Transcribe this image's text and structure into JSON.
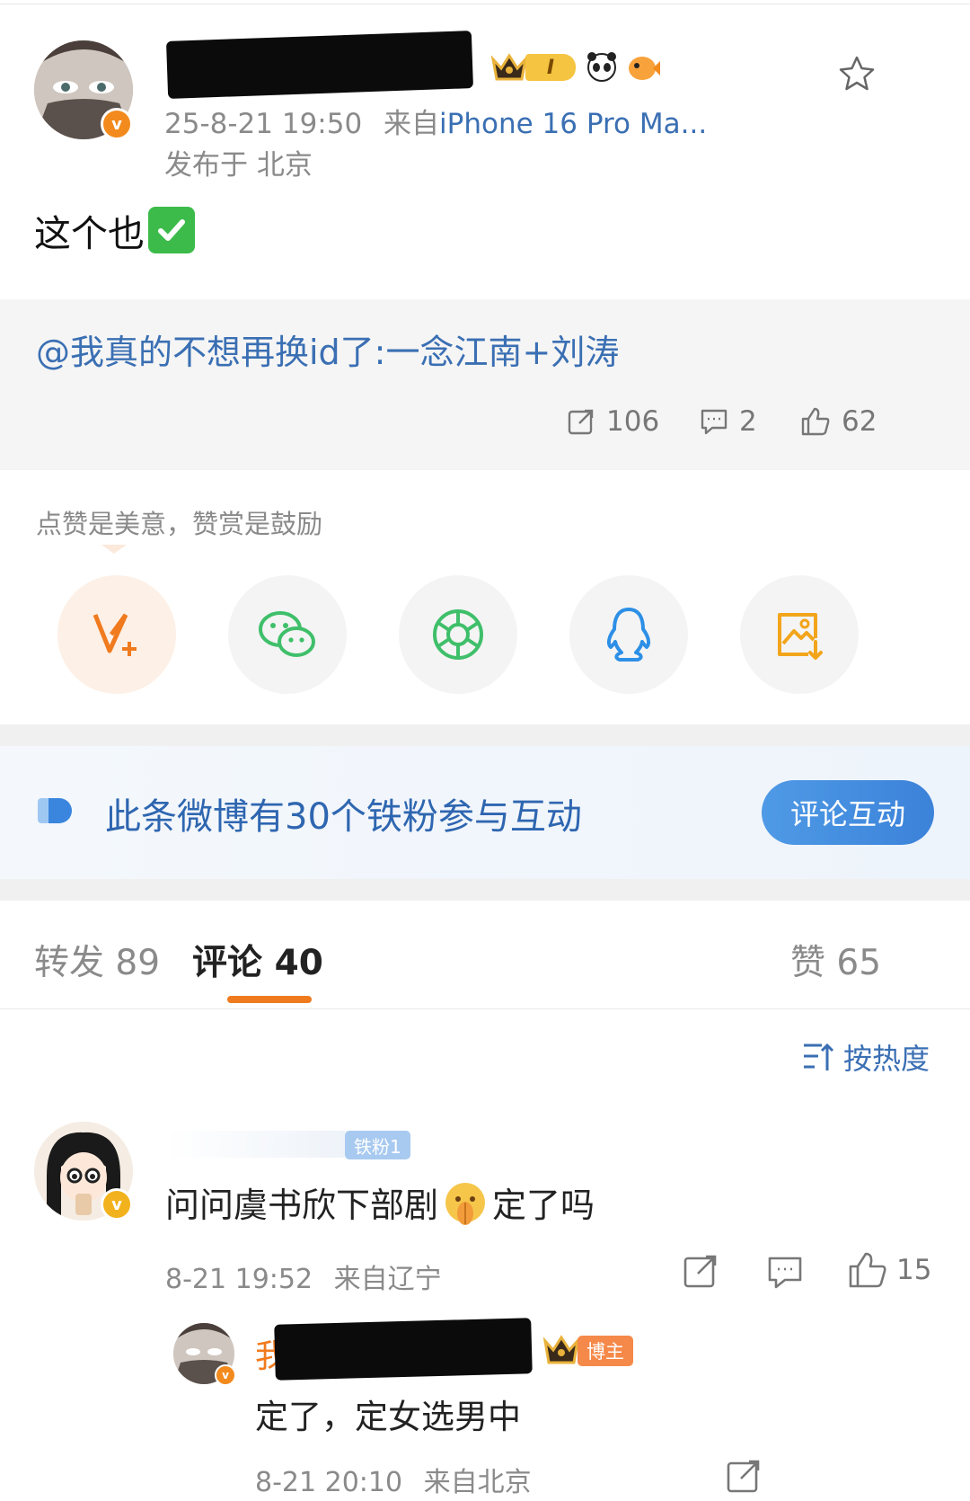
{
  "post": {
    "timestamp": "25-8-21 19:50",
    "source_prefix": "来自",
    "source_device": "iPhone 16 Pro Ma...",
    "location": "发布于 北京",
    "content_text": "这个也",
    "content_emoji": "✅",
    "level_badge": "I"
  },
  "repost": {
    "text": "@我真的不想再换id了:一念江南+刘涛",
    "share_count": "106",
    "comment_count": "2",
    "like_count": "62"
  },
  "share": {
    "hint": "点赞是美意，赞赏是鼓励",
    "buttons": [
      "v-plus-icon",
      "wechat-icon",
      "moments-icon",
      "qq-icon",
      "save-image-icon"
    ]
  },
  "iron_fans": {
    "text": "此条微博有30个铁粉参与互动",
    "button_label": "评论互动"
  },
  "tabs": {
    "repost": "转发 89",
    "comment": "评论 40",
    "like": "赞 65"
  },
  "sort_label": "按热度",
  "comments": [
    {
      "badge": "铁粉1",
      "text_before": "问问虞书欣下部剧",
      "text_after": "定了吗",
      "time": "8-21 19:52",
      "location": "来自辽宁",
      "like_count": "15",
      "reply": {
        "name_prefix": "我",
        "badge": "博主",
        "text": "定了，定女选男中",
        "time": "8-21 20:10",
        "location": "来自北京"
      }
    }
  ],
  "colors": {
    "accent_orange": "#f07a1e",
    "link_blue": "#3a6fb3",
    "wechat_green": "#3fbf6a",
    "qq_blue": "#2d8fe6"
  }
}
